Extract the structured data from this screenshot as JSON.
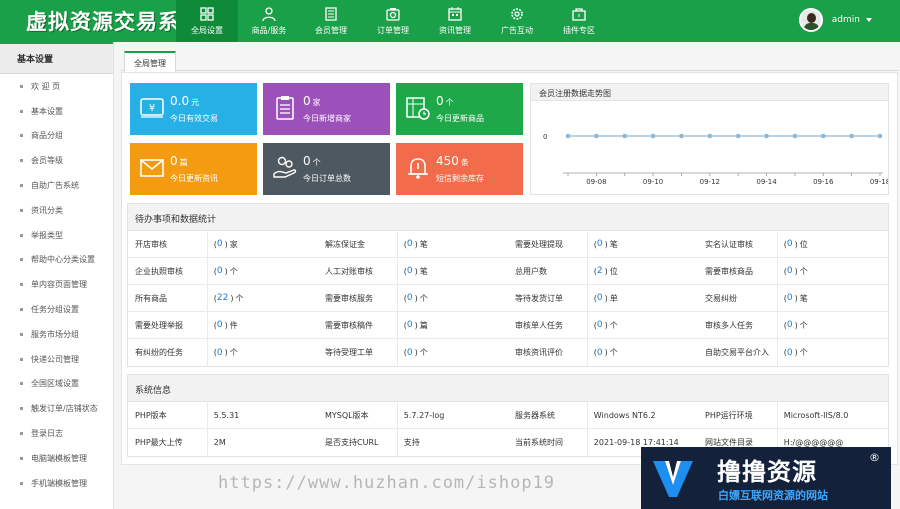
{
  "app": {
    "logo_text": "虚拟资源交易系统"
  },
  "nav": {
    "items": [
      {
        "label": "全局设置",
        "icon": "grid-icon"
      },
      {
        "label": "商品/服务",
        "icon": "user-icon"
      },
      {
        "label": "会员管理",
        "icon": "document-icon"
      },
      {
        "label": "订单管理",
        "icon": "camera-icon"
      },
      {
        "label": "资讯管理",
        "icon": "calendar-icon"
      },
      {
        "label": "广告互动",
        "icon": "gear-icon"
      },
      {
        "label": "插件专区",
        "icon": "bag-icon"
      }
    ],
    "active_index": 0
  },
  "user": {
    "name": "admin"
  },
  "sidebar": {
    "title": "基本设置",
    "items": [
      "欢 迎 页",
      "基本设置",
      "商品分组",
      "会员等级",
      "自助广告系统",
      "资讯分类",
      "举报类型",
      "帮助中心分类设置",
      "单内容页面管理",
      "任务分组设置",
      "服务市场分组",
      "快递公司管理",
      "全国区域设置",
      "触发订单/店铺状态",
      "登录日志",
      "电脑端模板管理",
      "手机端模板管理"
    ]
  },
  "tab": {
    "label": "全局管理"
  },
  "tiles": [
    {
      "value": "0.0",
      "unit": "元",
      "label": "今日有效交易",
      "color": "#26b0e6",
      "icon": "yen-icon"
    },
    {
      "value": "0",
      "unit": "家",
      "label": "今日新增商家",
      "color": "#9b51b9",
      "icon": "clipboard-icon"
    },
    {
      "value": "0",
      "unit": "个",
      "label": "今日更新商品",
      "color": "#1fa84a",
      "icon": "spreadsheet-clock-icon"
    },
    {
      "value": "0",
      "unit": "篇",
      "label": "今日更新资讯",
      "color": "#f39c12",
      "icon": "envelope-icon"
    },
    {
      "value": "0",
      "unit": "个",
      "label": "今日订单总数",
      "color": "#4e5860",
      "icon": "hand-coins-icon"
    },
    {
      "value": "450",
      "unit": "条",
      "label": "短信剩余库存",
      "color": "#f26b4b",
      "icon": "bell-icon"
    }
  ],
  "chart_data": {
    "type": "line",
    "title": "会员注册数据走势图",
    "x": [
      "09-07",
      "09-08",
      "09-09",
      "09-10",
      "09-11",
      "09-12",
      "09-13",
      "09-14",
      "09-15",
      "09-16",
      "09-17",
      "09-18"
    ],
    "x_tick_labels": [
      "09-08",
      "09-10",
      "09-12",
      "09-14",
      "09-16",
      "09-18"
    ],
    "series": [
      {
        "values": [
          0,
          0,
          0,
          0,
          0,
          0,
          0,
          0,
          0,
          0,
          0,
          0
        ]
      }
    ],
    "y_tick_labels": [
      "0"
    ],
    "ylim": [
      -1,
      1
    ],
    "line_color": "#8fb8d8",
    "grid": false
  },
  "todo": {
    "title": "待办事项和数据统计",
    "rows": [
      [
        {
          "label": "开店审核",
          "value": "0",
          "unit": "家"
        },
        {
          "label": "解冻保证金",
          "value": "0",
          "unit": "笔"
        },
        {
          "label": "需要处理提现",
          "value": "0",
          "unit": "笔"
        },
        {
          "label": "实名认证审核",
          "value": "0",
          "unit": "位"
        }
      ],
      [
        {
          "label": "企业执照审核",
          "value": "0",
          "unit": "个"
        },
        {
          "label": "人工对账审核",
          "value": "0",
          "unit": "笔"
        },
        {
          "label": "总用户数",
          "value": "2",
          "unit": "位"
        },
        {
          "label": "需要审核商品",
          "value": "0",
          "unit": "个"
        }
      ],
      [
        {
          "label": "所有商品",
          "value": "22",
          "unit": "个"
        },
        {
          "label": "需要审核服务",
          "value": "0",
          "unit": "个"
        },
        {
          "label": "等待发货订单",
          "value": "0",
          "unit": "单"
        },
        {
          "label": "交易纠纷",
          "value": "0",
          "unit": "笔"
        }
      ],
      [
        {
          "label": "需要处理举报",
          "value": "0",
          "unit": "件"
        },
        {
          "label": "需要审核稿件",
          "value": "0",
          "unit": "篇"
        },
        {
          "label": "审核单人任务",
          "value": "0",
          "unit": "个"
        },
        {
          "label": "审核多人任务",
          "value": "0",
          "unit": "个"
        }
      ],
      [
        {
          "label": "有纠纷的任务",
          "value": "0",
          "unit": "个"
        },
        {
          "label": "等待受理工单",
          "value": "0",
          "unit": "个"
        },
        {
          "label": "审核资讯评价",
          "value": "0",
          "unit": "个"
        },
        {
          "label": "自助交易平台介入",
          "value": "0",
          "unit": "个"
        }
      ]
    ]
  },
  "sysinfo": {
    "title": "系统信息",
    "rows": [
      [
        {
          "label": "PHP版本",
          "value": "5.5.31"
        },
        {
          "label": "MYSQL版本",
          "value": "5.7.27-log"
        },
        {
          "label": "服务器系统",
          "value": "Windows NT6.2"
        },
        {
          "label": "PHP运行环境",
          "value": "Microsoft-IIS/8.0"
        }
      ],
      [
        {
          "label": "PHP最大上传",
          "value": "2M"
        },
        {
          "label": "是否支持CURL",
          "value": "支持"
        },
        {
          "label": "当前系统时间",
          "value": "2021-09-18 17:41:14"
        },
        {
          "label": "网站文件目录",
          "value": "H:/@@@@@@"
        }
      ]
    ]
  },
  "watermark": {
    "url": "https://www.huzhan.com/ishop19",
    "title": "撸撸资源",
    "reg": "®",
    "subtitle": "白嫖互联网资源的网站"
  }
}
